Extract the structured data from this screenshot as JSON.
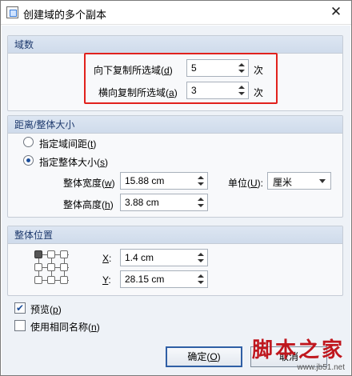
{
  "window": {
    "title": "创建域的多个副本",
    "close_glyph": "✕"
  },
  "group_count": {
    "header": "域数",
    "down": {
      "label": "向下复制所选域(",
      "mnemonic": "d",
      "close": ")",
      "value": "5",
      "unit": "次"
    },
    "across": {
      "label": "横向复制所选域(",
      "mnemonic": "a",
      "close": ")",
      "value": "3",
      "unit": "次"
    }
  },
  "group_spacing": {
    "header": "距离/整体大小",
    "option_spacing": {
      "label": "指定域间距(",
      "mnemonic": "t",
      "close": ")",
      "selected": false
    },
    "option_size": {
      "label": "指定整体大小(",
      "mnemonic": "s",
      "close": ")",
      "selected": true
    },
    "width": {
      "label": "整体宽度(",
      "mnemonic": "w",
      "close": ")",
      "value": "15.88 cm"
    },
    "height": {
      "label": "整体高度(",
      "mnemonic": "h",
      "close": ")",
      "value": "3.88 cm"
    },
    "unit": {
      "label": "单位(",
      "mnemonic": "U",
      "close": "):",
      "value": "厘米"
    }
  },
  "group_position": {
    "header": "整体位置",
    "x": {
      "mnemonic": "X",
      "suffix": ":",
      "value": "1.4 cm"
    },
    "y": {
      "mnemonic": "Y",
      "suffix": ":",
      "value": "28.15 cm"
    }
  },
  "preview": {
    "label": "预览(",
    "mnemonic": "p",
    "close": ")",
    "checked": true
  },
  "same_name": {
    "label": "使用相同名称(",
    "mnemonic": "n",
    "close": ")",
    "checked": false
  },
  "buttons": {
    "ok": {
      "label": "确定(",
      "mnemonic": "O",
      "close": ")"
    },
    "cancel": {
      "label": "取消"
    }
  },
  "watermark": {
    "text": "脚本之家",
    "url": "www.jb51.net"
  },
  "colors": {
    "highlight": "#e1211d",
    "group_header": "#1e3a6e",
    "watermark": "#c0171e"
  }
}
